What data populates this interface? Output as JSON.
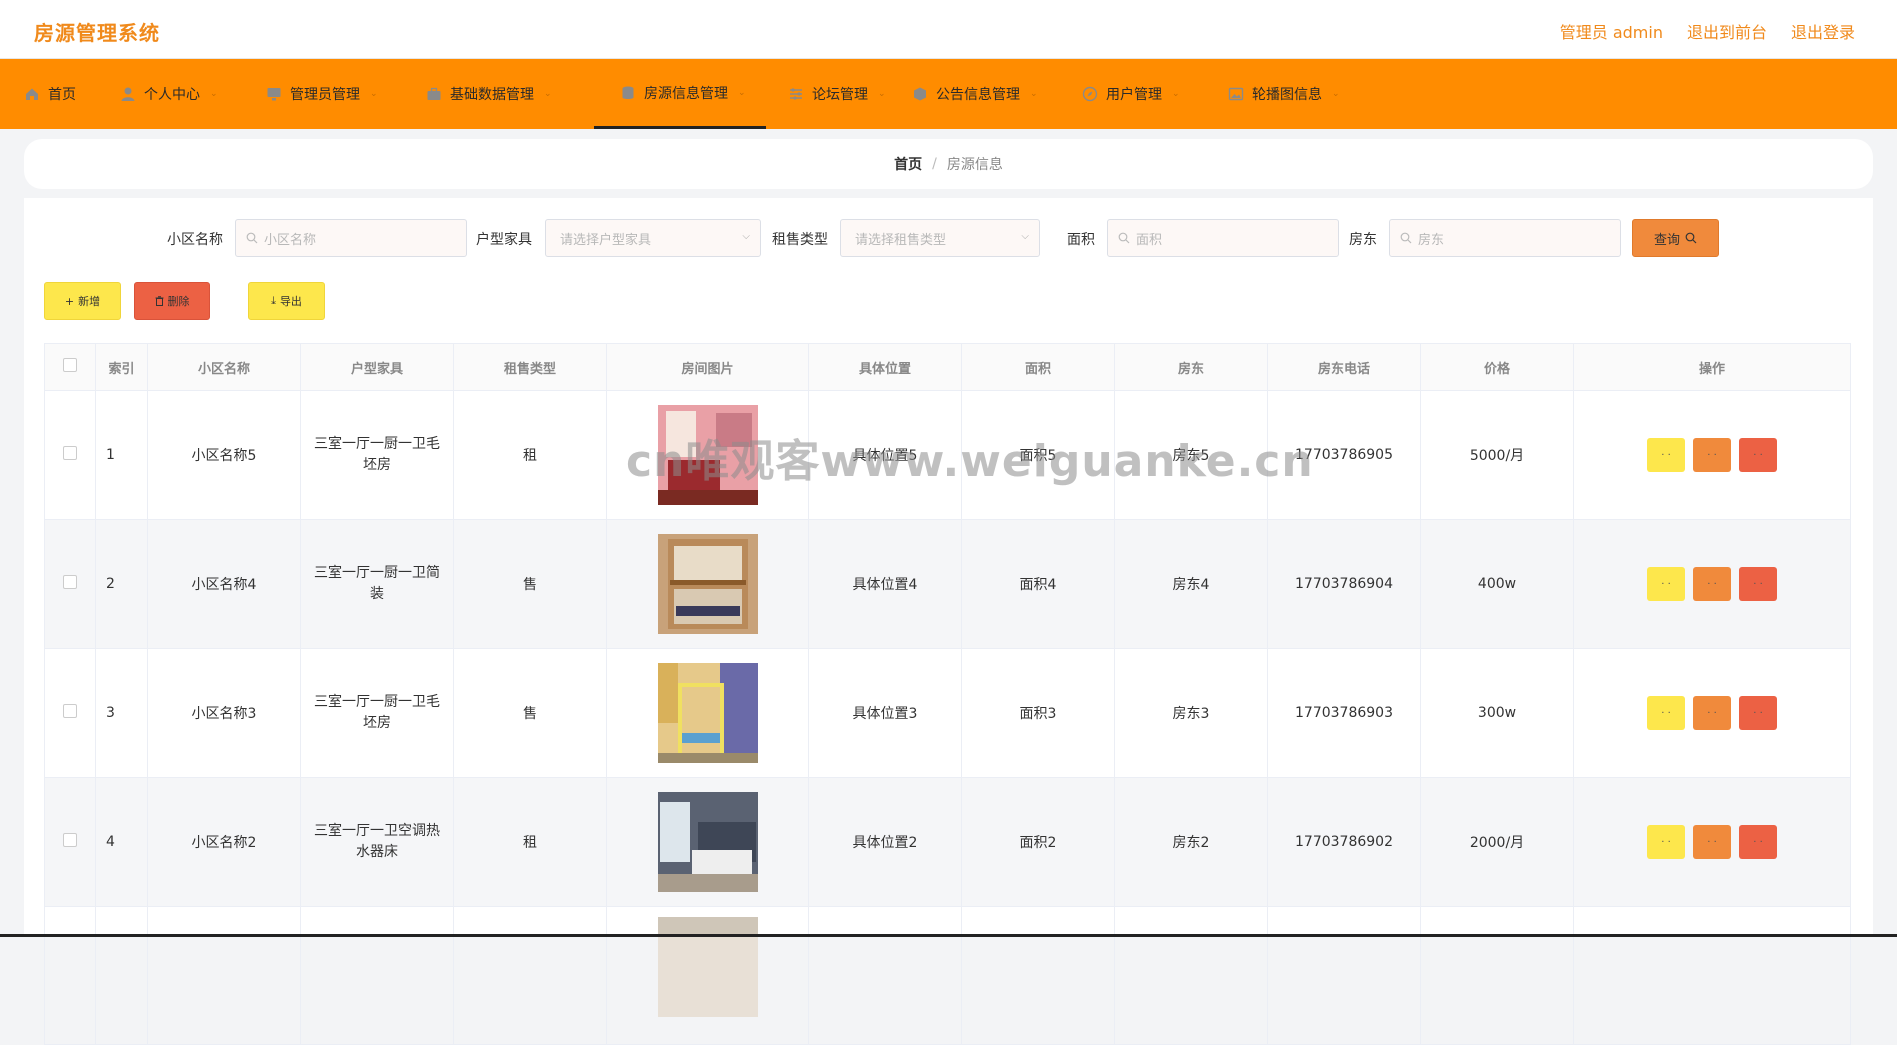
{
  "app": {
    "title": "房源管理系统",
    "links": [
      "管理员 admin",
      "退出到前台",
      "退出登录"
    ]
  },
  "nav": [
    {
      "label": "首页",
      "icon": "home-icon",
      "chevron": false
    },
    {
      "label": "个人中心",
      "icon": "user-icon",
      "chevron": true
    },
    {
      "label": "管理员管理",
      "icon": "monitor-icon",
      "chevron": true
    },
    {
      "label": "基础数据管理",
      "icon": "briefcase-icon",
      "chevron": true
    },
    {
      "label": "房源信息管理",
      "icon": "database-icon",
      "chevron": true,
      "active": true
    },
    {
      "label": "论坛管理",
      "icon": "sliders-icon",
      "chevron": true
    },
    {
      "label": "公告信息管理",
      "icon": "cube-icon",
      "chevron": true
    },
    {
      "label": "用户管理",
      "icon": "compass-icon",
      "chevron": true
    },
    {
      "label": "轮播图信息",
      "icon": "picture-icon",
      "chevron": true
    }
  ],
  "breadcrumb": {
    "home": "首页",
    "separator": "/",
    "current": "房源信息"
  },
  "search": {
    "community_label": "小区名称",
    "community_placeholder": "小区名称",
    "layout_label": "户型家具",
    "layout_placeholder": "请选择户型家具",
    "sale_type_label": "租售类型",
    "sale_type_placeholder": "请选择租售类型",
    "area_label": "面积",
    "area_placeholder": "面积",
    "landlord_label": "房东",
    "landlord_placeholder": "房东",
    "query_label": "查询"
  },
  "actions": {
    "add": "新增",
    "delete": "删除",
    "export": "导出"
  },
  "table": {
    "headers": [
      "索引",
      "小区名称",
      "户型家具",
      "租售类型",
      "房间图片",
      "具体位置",
      "面积",
      "房东",
      "房东电话",
      "价格",
      "操作"
    ],
    "rows": [
      {
        "index": "1",
        "community": "小区名称5",
        "layout": "三室一厅一厨一卫毛坯房",
        "sale_type": "租",
        "location": "具体位置5",
        "area": "面积5",
        "landlord": "房东5",
        "phone": "17703786905",
        "price": "5000/月"
      },
      {
        "index": "2",
        "community": "小区名称4",
        "layout": "三室一厅一厨一卫简装",
        "sale_type": "售",
        "location": "具体位置4",
        "area": "面积4",
        "landlord": "房东4",
        "phone": "17703786904",
        "price": "400w"
      },
      {
        "index": "3",
        "community": "小区名称3",
        "layout": "三室一厅一厨一卫毛坯房",
        "sale_type": "售",
        "location": "具体位置3",
        "area": "面积3",
        "landlord": "房东3",
        "phone": "17703786903",
        "price": "300w"
      },
      {
        "index": "4",
        "community": "小区名称2",
        "layout": "三室一厅一卫空调热水器床",
        "sale_type": "租",
        "location": "具体位置2",
        "area": "面积2",
        "landlord": "房东2",
        "phone": "17703786902",
        "price": "2000/月"
      }
    ]
  },
  "watermark": "cn唯观客www.weiguanke.cn",
  "colors": {
    "accent": "#ff8c00",
    "title": "#f08a1c",
    "btn_yellow": "#fde74c",
    "btn_orange": "#f08a3c",
    "btn_red": "#ec6144"
  }
}
